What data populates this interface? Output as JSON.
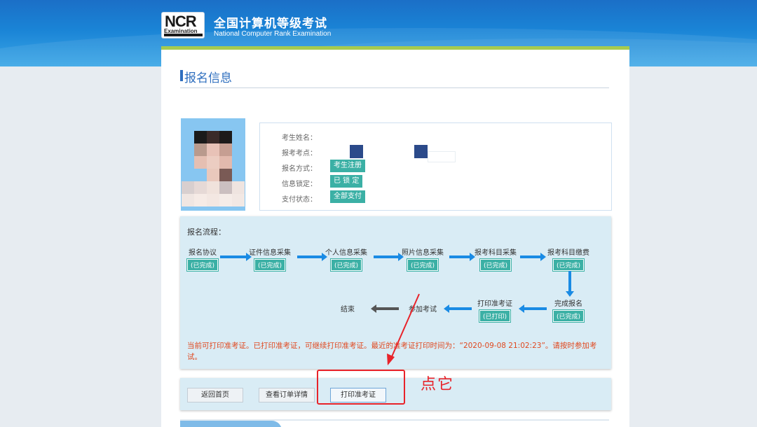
{
  "header": {
    "logo_mark": "NCR",
    "logo_word": "Examination",
    "title": "全国计算机等级考试",
    "subtitle": "National Computer Rank Examination"
  },
  "section": {
    "title": "报名信息"
  },
  "candidate": {
    "fields": [
      {
        "label": "考生姓名："
      },
      {
        "label": "报考考点："
      },
      {
        "label": "报名方式：",
        "value": "考生注册"
      },
      {
        "label": "信息锁定：",
        "value": "已 锁 定"
      },
      {
        "label": "支付状态：",
        "value": "全部支付"
      }
    ]
  },
  "flow": {
    "label": "报名流程：",
    "steps": [
      {
        "name": "报名协议",
        "status": "(已完成)"
      },
      {
        "name": "证件信息采集",
        "status": "(已完成)"
      },
      {
        "name": "个人信息采集",
        "status": "(已完成)"
      },
      {
        "name": "照片信息采集",
        "status": "(已完成)"
      },
      {
        "name": "报考科目采集",
        "status": "(已完成)"
      },
      {
        "name": "报考科目缴费",
        "status": "(已完成)"
      },
      {
        "name": "完成报名",
        "status": "(已完成)"
      },
      {
        "name": "打印准考证",
        "status": "(已打印)"
      },
      {
        "name": "参加考试"
      },
      {
        "name": "结束"
      }
    ],
    "notice": "当前可打印准考证。已打印准考证，可继续打印准考证。最近的准考证打印时间为：“2020-09-08 21:02:23”。请按时参加考试。"
  },
  "buttons": {
    "home": "返回首页",
    "order": "查看订单详情",
    "print": "打印准考证"
  },
  "annotation": {
    "text": "点它",
    "color": "#e8232a"
  },
  "colors": {
    "accent": "#2f6fbf",
    "badge": "#3bb0a5",
    "arrow": "#1a8be4",
    "notice": "#e0481f",
    "topbar_green": "#a6cb4f"
  }
}
